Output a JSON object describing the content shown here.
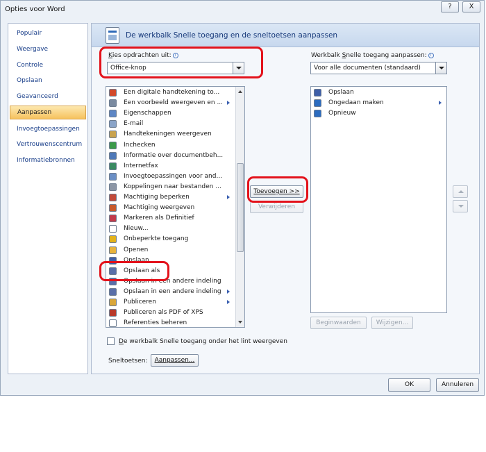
{
  "window": {
    "title": "Opties voor Word",
    "help_label": "?",
    "close_label": "X"
  },
  "sidebar": {
    "items": [
      {
        "label": "Populair"
      },
      {
        "label": "Weergave"
      },
      {
        "label": "Controle"
      },
      {
        "label": "Opslaan"
      },
      {
        "label": "Geavanceerd"
      },
      {
        "label": "Aanpassen",
        "active": true
      },
      {
        "label": "Invoegtoepassingen"
      },
      {
        "label": "Vertrouwenscentrum"
      },
      {
        "label": "Informatiebronnen"
      }
    ]
  },
  "header": {
    "title": "De werkbalk Snelle toegang en de sneltoetsen aanpassen"
  },
  "choose": {
    "label_underlined": "K",
    "label_rest": "ies opdrachten uit:",
    "value": "Office-knop"
  },
  "qat": {
    "label_pre": "Werkbalk ",
    "label_underlined": "S",
    "label_rest": "nelle toegang aanpassen:",
    "value": "Voor alle documenten (standaard)"
  },
  "commands": [
    {
      "label": "Een digitale handtekening to...",
      "icon": "ribbon-seal-icon",
      "color": "#d24a2a",
      "sub": false
    },
    {
      "label": "Een voorbeeld weergeven en ...",
      "icon": "print-preview-icon",
      "color": "#7a8aa0",
      "sub": true
    },
    {
      "label": "Eigenschappen",
      "icon": "properties-icon",
      "color": "#5d86c4",
      "sub": false
    },
    {
      "label": "E-mail",
      "icon": "email-icon",
      "color": "#8aa4c8",
      "sub": false
    },
    {
      "label": "Handtekeningen weergeven",
      "icon": "signatures-icon",
      "color": "#c9a34e",
      "sub": false
    },
    {
      "label": "Inchecken",
      "icon": "check-in-icon",
      "color": "#3c9a4a",
      "sub": false
    },
    {
      "label": "Informatie over documentbeh...",
      "icon": "document-info-icon",
      "color": "#4f79b8",
      "sub": false
    },
    {
      "label": "Internetfax",
      "icon": "internet-fax-icon",
      "color": "#3a8a62",
      "sub": false
    },
    {
      "label": "Invoegtoepassingen voor and...",
      "icon": "addins-icon",
      "color": "#6b8fc5",
      "sub": false
    },
    {
      "label": "Koppelingen naar bestanden ...",
      "icon": "links-icon",
      "color": "#8c96a5",
      "sub": false
    },
    {
      "label": "Machtiging beperken",
      "icon": "restrict-permission-icon",
      "color": "#c24a3a",
      "sub": true
    },
    {
      "label": "Machtiging weergeven",
      "icon": "view-permission-icon",
      "color": "#c85a2c",
      "sub": false
    },
    {
      "label": "Markeren als Definitief",
      "icon": "mark-final-icon",
      "color": "#c23a4a",
      "sub": false
    },
    {
      "label": "Nieuw...",
      "icon": "new-document-icon",
      "color": "#ffffff",
      "sub": false
    },
    {
      "label": "Onbeperkte toegang",
      "icon": "checkmark-icon",
      "color": "#e3b21a",
      "sub": false
    },
    {
      "label": "Openen",
      "icon": "open-folder-icon",
      "color": "#e8b33c",
      "sub": false
    },
    {
      "label": "Opslaan",
      "icon": "save-icon",
      "color": "#3f5fa8",
      "sub": false
    },
    {
      "label": "Opslaan als",
      "icon": "save-as-icon",
      "color": "#5a6fa8",
      "sub": false
    },
    {
      "label": "Opslaan in een andere indeling",
      "icon": "save-other-format-icon",
      "color": "#5a6fa8",
      "sub": false
    },
    {
      "label": "Opslaan in een andere indeling",
      "icon": "save-other-format-icon",
      "color": "#5a6fa8",
      "sub": true
    },
    {
      "label": "Publiceren",
      "icon": "publish-icon",
      "color": "#d9a63a",
      "sub": true
    },
    {
      "label": "Publiceren als PDF of XPS",
      "icon": "pdf-xps-icon",
      "color": "#b83a2a",
      "sub": false
    },
    {
      "label": "Referenties beheren",
      "icon": "references-icon",
      "color": "#ffffff",
      "sub": false
    }
  ],
  "qat_items": [
    {
      "label": "Opslaan",
      "icon": "save-icon",
      "color": "#3f5fa8",
      "sub": false
    },
    {
      "label": "Ongedaan maken",
      "icon": "undo-icon",
      "color": "#2c6cc0",
      "sub": true
    },
    {
      "label": "Opnieuw",
      "icon": "redo-icon",
      "color": "#2c6cc0",
      "sub": false
    }
  ],
  "buttons": {
    "add_label": "Toevoegen >>",
    "remove_label": "Verwijderen",
    "reset_label": "Beginwaarden",
    "modify_label": "Wijzigen...",
    "customize_label": "Aanpassen...",
    "ok_label": "OK",
    "cancel_label": "Annuleren"
  },
  "options": {
    "show_below_ribbon_underlined": "D",
    "show_below_ribbon_rest": "e werkbalk Snelle toegang onder het lint weergeven",
    "show_below_ribbon_checked": false,
    "shortcuts_label": "Sneltoetsen:"
  }
}
